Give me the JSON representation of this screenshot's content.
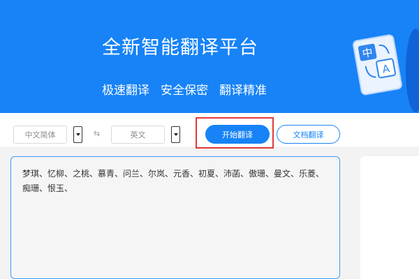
{
  "banner": {
    "title": "全新智能翻译平台",
    "features": [
      "极速翻译",
      "安全保密",
      "翻译精准"
    ],
    "illustration": {
      "icon": "translate-document-icon",
      "glyph_zh": "中",
      "glyph_en": "A"
    }
  },
  "toolbar": {
    "source_lang": "中文简体",
    "target_lang": "英文",
    "swap_symbol": "⇆",
    "start_label": "开始翻译",
    "doc_label": "文档翻译"
  },
  "editor": {
    "source_text": "梦琪、忆柳、之桃、慕青、问兰、尔岚、元香、初夏、沛菡、傲珊、曼文、乐菱、\n痴珊、恨玉、"
  },
  "colors": {
    "primary": "#1783f7",
    "highlight": "#e03a3a"
  }
}
